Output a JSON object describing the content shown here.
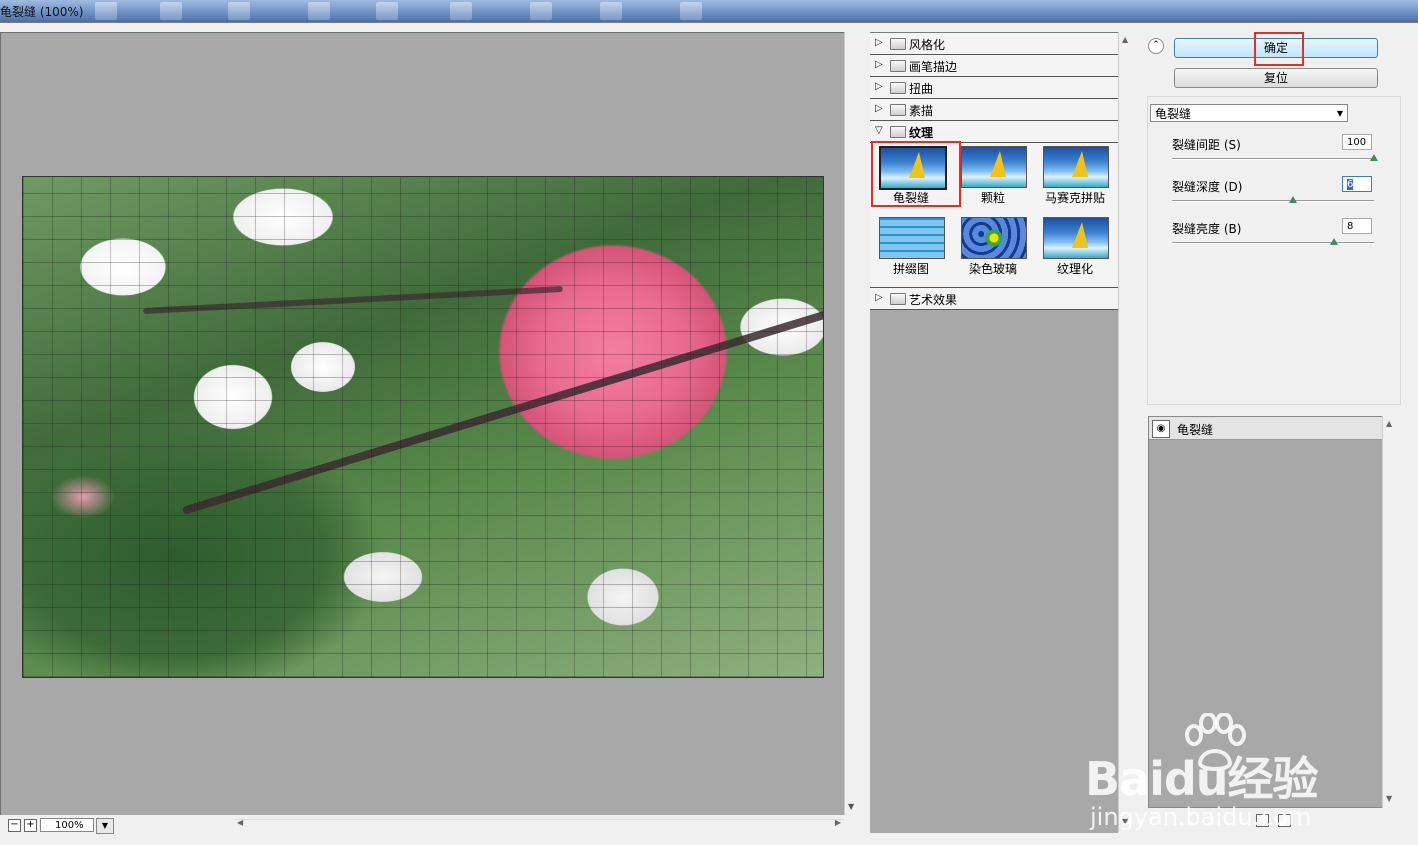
{
  "window": {
    "title": "龟裂缝 (100%)"
  },
  "preview": {
    "zoom": "100%",
    "zoom_out": "−",
    "zoom_in": "+"
  },
  "gallery": {
    "categories": [
      {
        "label": "风格化",
        "open": false
      },
      {
        "label": "画笔描边",
        "open": false
      },
      {
        "label": "扭曲",
        "open": false
      },
      {
        "label": "素描",
        "open": false
      },
      {
        "label": "纹理",
        "open": true
      },
      {
        "label": "艺术效果",
        "open": false
      }
    ],
    "thumbnails": [
      {
        "label": "龟裂缝",
        "selected": true
      },
      {
        "label": "颗粒",
        "selected": false
      },
      {
        "label": "马赛克拼贴",
        "selected": false
      },
      {
        "label": "拼缀图",
        "selected": false
      },
      {
        "label": "染色玻璃",
        "selected": false
      },
      {
        "label": "纹理化",
        "selected": false
      }
    ]
  },
  "panel": {
    "ok_label": "确定",
    "reset_label": "复位",
    "filter_select": "龟裂缝",
    "params": [
      {
        "label": "裂缝间距 (S)",
        "value": "100",
        "fraction": 1.0
      },
      {
        "label": "裂缝深度 (D)",
        "value": "6",
        "fraction": 0.6
      },
      {
        "label": "裂缝亮度 (B)",
        "value": "8",
        "fraction": 0.8
      }
    ],
    "layer_name": "龟裂缝"
  },
  "watermark": {
    "brand": "Baidu经验",
    "url": "jingyan.baidu.com"
  },
  "colors": {
    "highlight_box": "#e0302a",
    "canvas_gray": "#a8a8a8"
  }
}
